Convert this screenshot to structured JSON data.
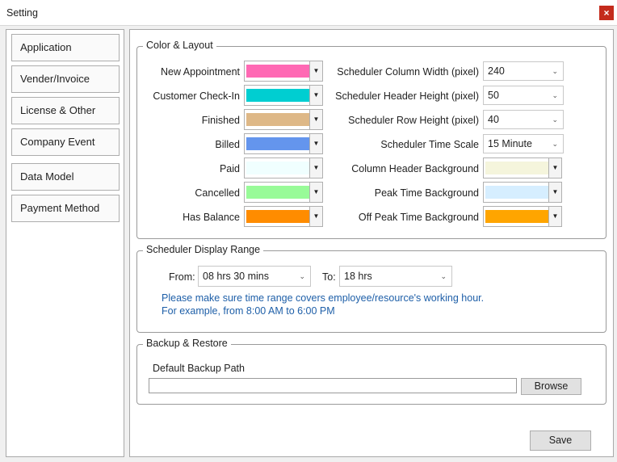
{
  "window": {
    "title": "Setting",
    "close_glyph": "×"
  },
  "sidebar": {
    "items": [
      {
        "label": "Application"
      },
      {
        "label": "Vender/Invoice"
      },
      {
        "label": "License & Other"
      },
      {
        "label": "Company Event"
      },
      {
        "label": "Data Model"
      },
      {
        "label": "Payment Method"
      }
    ]
  },
  "color_layout": {
    "title": "Color & Layout",
    "status_colors": [
      {
        "label": "New Appointment",
        "color": "#ff69b4"
      },
      {
        "label": "Customer Check-In",
        "color": "#00ced1"
      },
      {
        "label": "Finished",
        "color": "#deb887"
      },
      {
        "label": "Billed",
        "color": "#6495ed"
      },
      {
        "label": "Paid",
        "color": "#f0ffff"
      },
      {
        "label": "Cancelled",
        "color": "#98fb98"
      },
      {
        "label": "Has Balance",
        "color": "#ff8c00"
      }
    ],
    "scheduler_settings": [
      {
        "label": "Scheduler Column Width (pixel)",
        "value": "240"
      },
      {
        "label": "Scheduler Header Height (pixel)",
        "value": "50"
      },
      {
        "label": "Scheduler Row Height (pixel)",
        "value": "40"
      },
      {
        "label": "Scheduler Time Scale",
        "value": "15 Minute"
      }
    ],
    "background_colors": [
      {
        "label": "Column Header Background",
        "color": "#f5f5dc"
      },
      {
        "label": "Peak Time Background",
        "color": "#d6eeff"
      },
      {
        "label": "Off Peak Time Background",
        "color": "#ffa500"
      }
    ]
  },
  "display_range": {
    "title": "Scheduler Display Range",
    "from_label": "From:",
    "from_value": "08 hrs 30 mins",
    "to_label": "To:",
    "to_value": "18 hrs",
    "note_line1": "Please make sure time range covers employee/resource's working hour.",
    "note_line2": "For example, from 8:00 AM to 6:00 PM"
  },
  "backup": {
    "title": "Backup & Restore",
    "path_label": "Default Backup Path",
    "path_value": "",
    "browse_label": "Browse"
  },
  "footer": {
    "save_label": "Save"
  },
  "icons": {
    "dropdown": "chevron-down-icon",
    "close": "close-icon"
  }
}
